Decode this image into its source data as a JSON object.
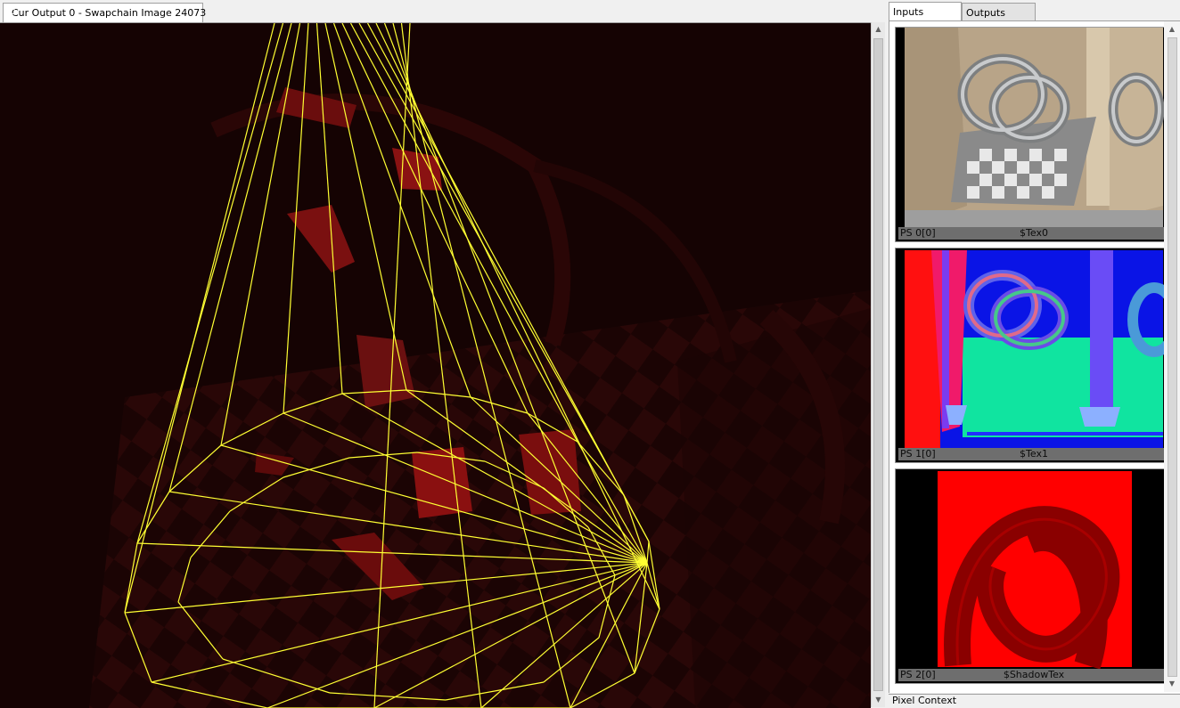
{
  "main_tab": {
    "label": "Cur Output 0 - Swapchain Image 24073",
    "icon": "texture-viewer-icon"
  },
  "right_panel": {
    "tabs": [
      {
        "label": "Inputs",
        "active": true
      },
      {
        "label": "Outputs",
        "active": false
      }
    ],
    "thumbnails": [
      {
        "slot": "PS 0[0]",
        "name": "$Tex0",
        "preview": "lit-scene-preview"
      },
      {
        "slot": "PS 1[0]",
        "name": "$Tex1",
        "preview": "normals-preview"
      },
      {
        "slot": "PS 2[0]",
        "name": "$ShadowTex",
        "preview": "shadow-map-preview"
      }
    ],
    "footer_label": "Pixel Context"
  },
  "colors": {
    "viewport_bg": "#150303",
    "wireframe": "#ffff33",
    "tab_icon": "#3aa35a",
    "caption_bg": "#6e6e6e"
  }
}
